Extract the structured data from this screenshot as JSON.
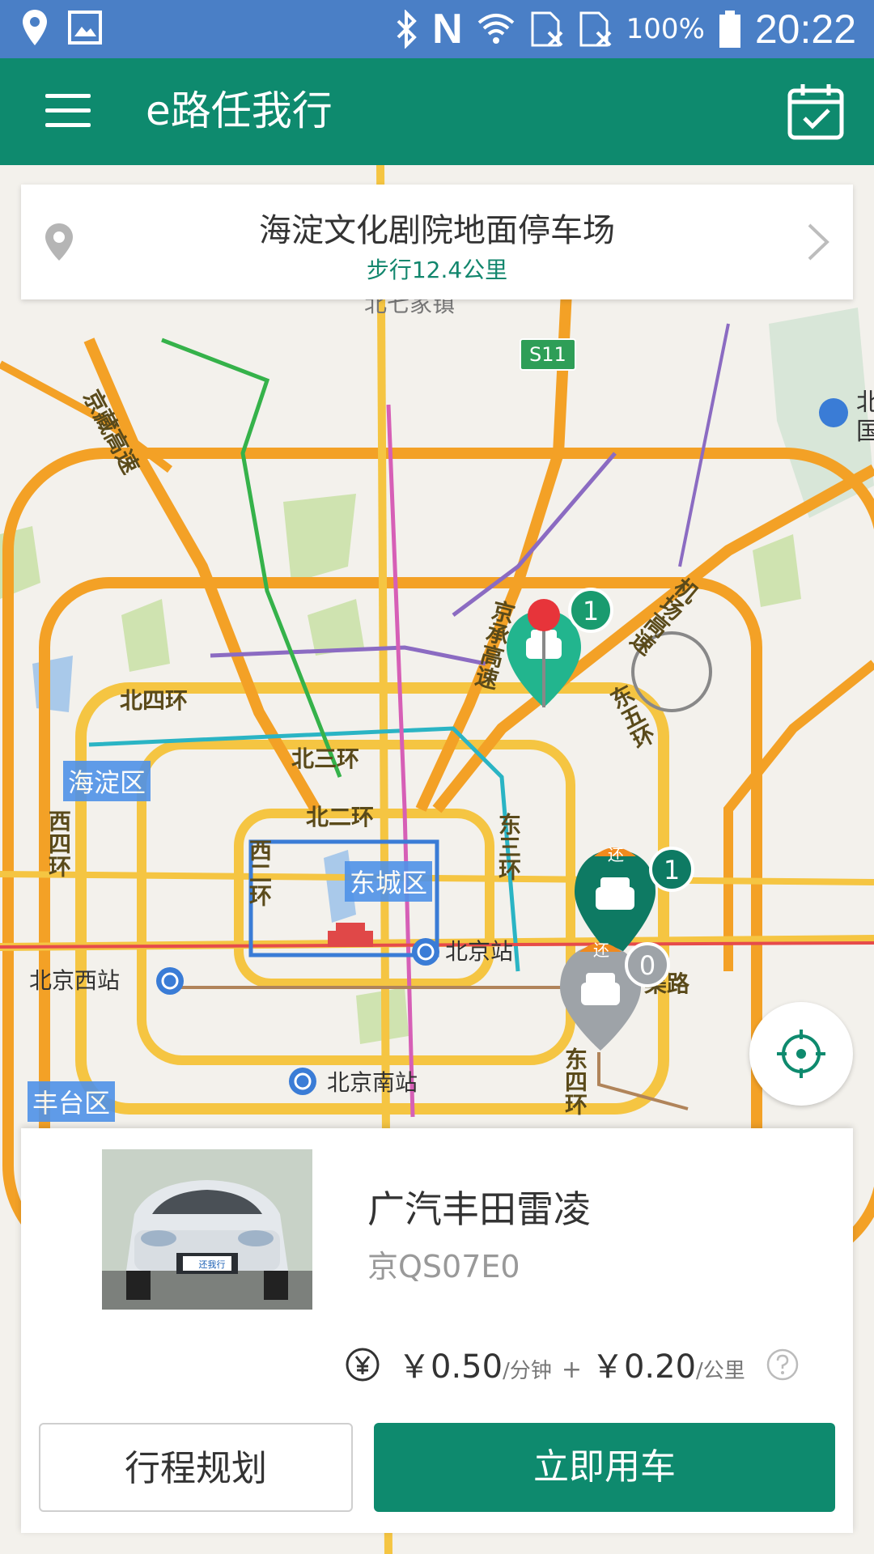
{
  "status_bar": {
    "battery": "100%",
    "time": "20:22",
    "icons": [
      "location-icon",
      "image-icon",
      "bluetooth-icon",
      "nfc-icon",
      "wifi-icon",
      "sim-off-icon",
      "sim-off-icon",
      "battery-icon"
    ]
  },
  "app_bar": {
    "title": "e路任我行",
    "menu_icon": "hamburger-menu-icon",
    "calendar_icon": "calendar-check-icon"
  },
  "location_card": {
    "name": "海淀文化剧院地面停车场",
    "distance": "步行12.4公里"
  },
  "map": {
    "road_labels": [
      "北二环",
      "北七家镇",
      "京藏高速",
      "北四环",
      "北三环",
      "北二环",
      "西二环",
      "西四环",
      "东三环",
      "京承高速",
      "机场高速",
      "东五环",
      "东四环",
      "渠路"
    ],
    "shield": "S11",
    "districts": [
      "海淀区",
      "东城区",
      "丰台区"
    ],
    "stations": [
      "北京站",
      "北京西站",
      "北京南站"
    ],
    "markers": [
      {
        "count": "1",
        "badge": ""
      },
      {
        "count": "1",
        "badge": "还"
      },
      {
        "count": "0",
        "badge": "还"
      }
    ],
    "partial_text": [
      "北",
      "国"
    ]
  },
  "car": {
    "name": "广汽丰田雷凌",
    "plate": "京QS07E0",
    "price_time": "￥0.50",
    "unit_time": "/分钟",
    "plus": "+",
    "price_km": "￥0.20",
    "unit_km": "/公里",
    "photo_text": "还我行"
  },
  "buttons": {
    "plan": "行程规划",
    "go": "立即用车"
  }
}
